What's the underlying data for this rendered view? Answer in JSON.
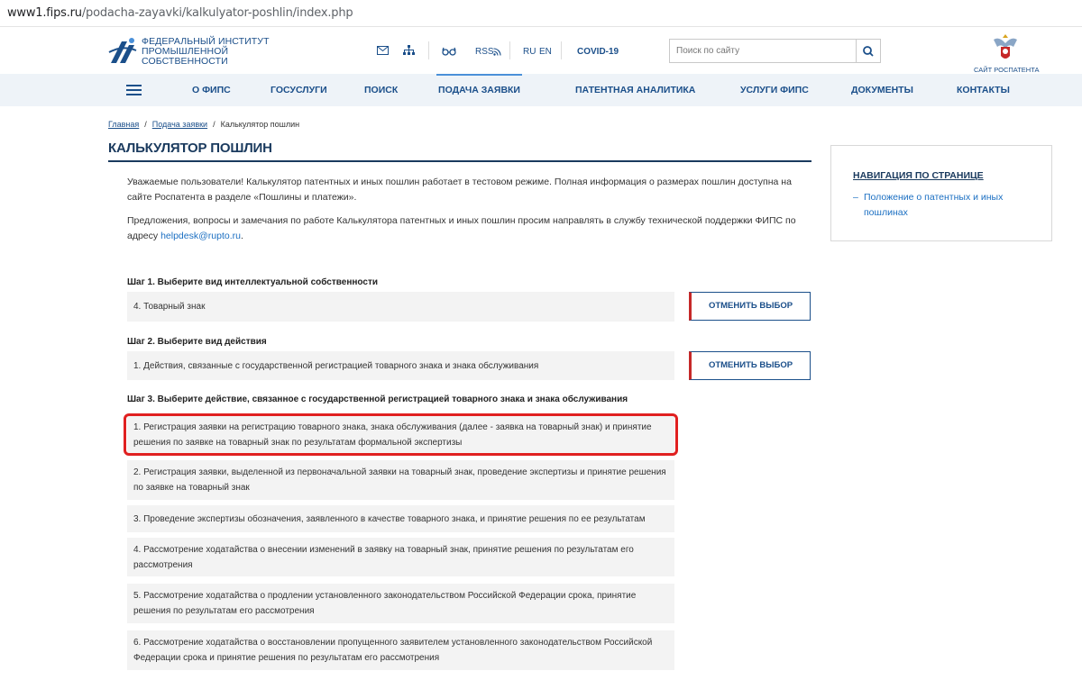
{
  "browser": {
    "url_domain": "www1.fips.ru",
    "url_path": "/podacha-zayavki/kalkulyator-poshlin/index.php"
  },
  "header": {
    "logo_lines": [
      "ФЕДЕРАЛЬНЫЙ ИНСТИТУТ",
      "ПРОМЫШЛЕННОЙ",
      "СОБСТВЕННОСТИ"
    ],
    "icons": [
      "mail-icon",
      "sitemap-icon",
      "accessibility-glasses-icon",
      "rss-icon"
    ],
    "rss_label": "RSS",
    "lang_ru": "RU",
    "lang_en": "EN",
    "covid": "COVID-19",
    "search_placeholder": "Поиск по сайту",
    "rospatent_label": "САЙТ РОСПАТЕНТА"
  },
  "nav": {
    "items": [
      "О ФИПС",
      "ГОСУСЛУГИ",
      "ПОИСК",
      "ПОДАЧА ЗАЯВКИ",
      "ПАТЕНТНАЯ АНАЛИТИКА",
      "УСЛУГИ ФИПС",
      "ДОКУМЕНТЫ",
      "КОНТАКТЫ"
    ],
    "active": "ПОДАЧА ЗАЯВКИ"
  },
  "breadcrumb": {
    "home": "Главная",
    "section": "Подача заявки",
    "current": "Калькулятор пошлин"
  },
  "page": {
    "title": "КАЛЬКУЛЯТОР ПОШЛИН",
    "intro1": "Уважаемые пользователи! Калькулятор патентных и иных пошлин работает в тестовом режиме. Полная информация о размерах пошлин доступна на сайте Роспатента в разделе «Пошлины и платежи».",
    "intro2": "Предложения, вопросы и замечания по работе Калькулятора патентных и иных пошлин просим направлять в службу технической поддержки ФИПС по адресу ",
    "email": "helpdesk@rupto.ru",
    "intro2_end": "."
  },
  "sidebar": {
    "heading": "НАВИГАЦИЯ ПО СТРАНИЦЕ",
    "link": "Положение о патентных и иных пошлинах"
  },
  "steps": {
    "step1_title": "Шаг 1. Выберите вид интеллектуальной собственности",
    "step1_value": "4. Товарный знак",
    "step2_title": "Шаг 2. Выберите вид действия",
    "step2_value": "1. Действия, связанные с государственной регистрацией товарного знака и знака обслуживания",
    "cancel_label": "ОТМЕНИТЬ ВЫБОР",
    "step3_title": "Шаг 3. Выберите действие, связанное с государственной регистрацией товарного знака и знака обслуживания"
  },
  "options": [
    "1. Регистрация заявки на регистрацию товарного знака, знака обслуживания (далее - заявка на товарный знак) и принятие решения по заявке на товарный знак по результатам формальной экспертизы",
    "2. Регистрация заявки, выделенной из первоначальной заявки на товарный знак, проведение экспертизы и принятие решения по заявке на товарный знак",
    "3. Проведение экспертизы обозначения, заявленного в качестве товарного знака, и принятие решения по ее результатам",
    "4. Рассмотрение ходатайства о внесении изменений в заявку на товарный знак, принятие решения по результатам его рассмотрения",
    "5. Рассмотрение ходатайства о продлении установленного законодательством Российской Федерации срока, принятие решения по результатам его рассмотрения",
    "6. Рассмотрение ходатайства о восстановлении пропущенного заявителем установленного законодательством Российской Федерации срока и принятие решения по результатам его рассмотрения"
  ],
  "colors": {
    "brand": "#1b4f8a",
    "highlight": "#e02020",
    "cancel_accent": "#c62828"
  }
}
